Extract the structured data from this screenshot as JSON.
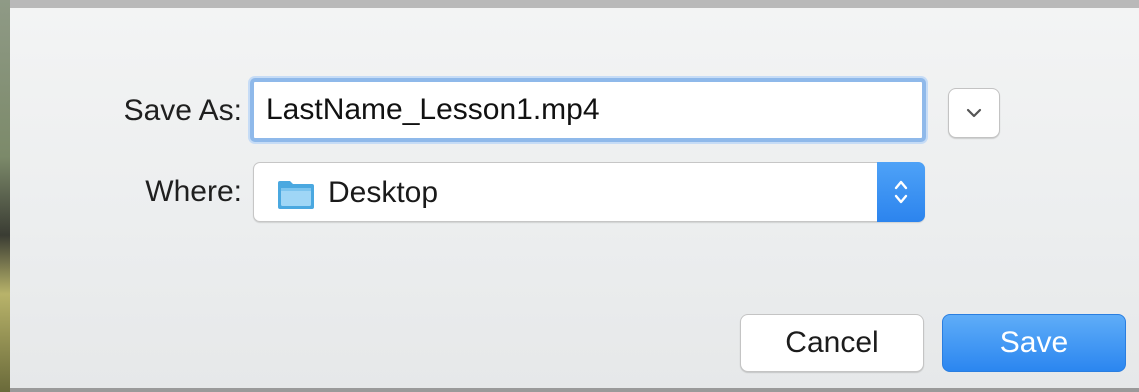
{
  "dialog": {
    "save_as_label": "Save As:",
    "filename_value": "LastName_Lesson1.mp4",
    "where_label": "Where:",
    "location": {
      "label": "Desktop",
      "icon": "folder-icon"
    },
    "expand_icon": "chevron-down-icon",
    "stepper_icon": "up-down-arrows-icon",
    "cancel_label": "Cancel",
    "save_label": "Save"
  },
  "colors": {
    "accent": "#2c84ee",
    "focus_ring": "#8fb9ea",
    "folder": "#5bb4e8"
  }
}
